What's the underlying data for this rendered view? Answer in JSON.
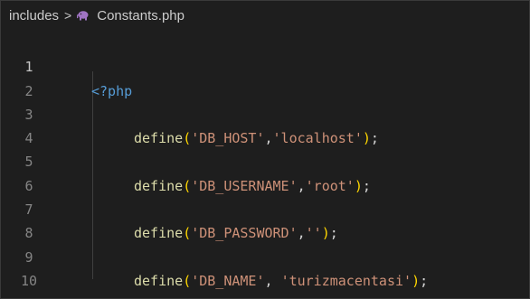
{
  "breadcrumb": {
    "folder": "includes",
    "separator": ">",
    "file": "Constants.php",
    "file_icon": "php-elephant-icon"
  },
  "line_numbers": [
    "1",
    "2",
    "3",
    "4",
    "5",
    "6",
    "7",
    "8",
    "9",
    "10"
  ],
  "code": {
    "line1": {
      "tag": "<?php"
    },
    "line3": {
      "fn": "define",
      "open": "(",
      "arg1": "'DB_HOST'",
      "comma": ",",
      "arg2": "'localhost'",
      "close": ")",
      "semi": ";"
    },
    "line5": {
      "fn": "define",
      "open": "(",
      "arg1": "'DB_USERNAME'",
      "comma": ",",
      "arg2": "'root'",
      "close": ")",
      "semi": ";"
    },
    "line7": {
      "fn": "define",
      "open": "(",
      "arg1": "'DB_PASSWORD'",
      "comma": ",",
      "arg2": "''",
      "close": ")",
      "semi": ";"
    },
    "line9": {
      "fn": "define",
      "open": "(",
      "arg1": "'DB_NAME'",
      "comma": ", ",
      "arg2": "'turizmacentasi'",
      "close": ")",
      "semi": ";"
    }
  },
  "colors": {
    "background": "#1e1e1e",
    "keyword": "#569cd6",
    "function": "#dcdcaa",
    "bracket": "#ffd700",
    "string": "#ce9178",
    "line_number": "#858585",
    "php_icon": "#a074c4"
  }
}
